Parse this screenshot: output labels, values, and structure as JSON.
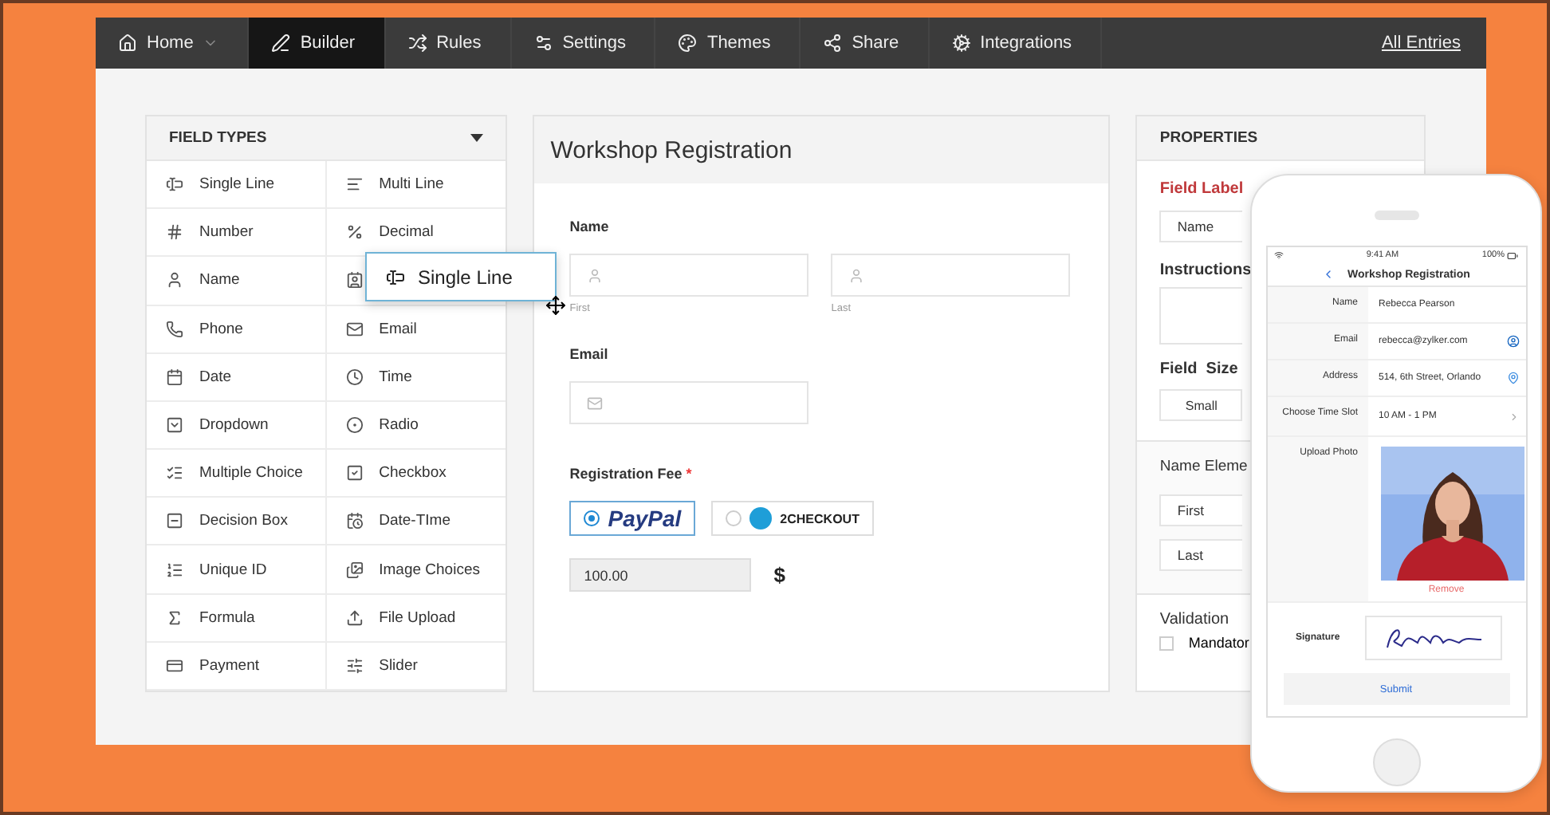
{
  "nav": {
    "items": [
      {
        "label": "Home",
        "dropdown": true,
        "selected": false
      },
      {
        "label": "Builder",
        "dropdown": false,
        "selected": true
      },
      {
        "label": "Rules",
        "dropdown": false,
        "selected": false
      },
      {
        "label": "Settings",
        "dropdown": false,
        "selected": false
      },
      {
        "label": "Themes",
        "dropdown": false,
        "selected": false
      },
      {
        "label": "Share",
        "dropdown": false,
        "selected": false
      },
      {
        "label": "Integrations",
        "dropdown": false,
        "selected": false
      }
    ],
    "link": "All Entries"
  },
  "field_types": {
    "title": "FIELD TYPES",
    "items": [
      {
        "kind": "field",
        "label": "Single Line"
      },
      {
        "kind": "field",
        "label": "Multi Line"
      },
      {
        "kind": "field",
        "label": "Number"
      },
      {
        "kind": "field",
        "label": "Decimal"
      },
      {
        "kind": "field",
        "label": "Name"
      },
      {
        "kind": "covered"
      },
      {
        "kind": "field",
        "label": "Phone"
      },
      {
        "kind": "field",
        "label": "Email"
      },
      {
        "kind": "field",
        "label": "Date"
      },
      {
        "kind": "field",
        "label": "Time"
      },
      {
        "kind": "field",
        "label": "Dropdown"
      },
      {
        "kind": "field",
        "label": "Radio"
      },
      {
        "kind": "field",
        "label": "Multiple Choice"
      },
      {
        "kind": "field",
        "label": "Checkbox"
      },
      {
        "kind": "field",
        "label": "Decision Box"
      },
      {
        "kind": "field",
        "label": "Date-TIme"
      },
      {
        "kind": "field",
        "label": "Unique ID"
      },
      {
        "kind": "field",
        "label": "Image Choices"
      },
      {
        "kind": "field",
        "label": "Formula"
      },
      {
        "kind": "field",
        "label": "File Upload"
      },
      {
        "kind": "field",
        "label": "Payment"
      },
      {
        "kind": "field",
        "label": "Slider"
      }
    ],
    "dragging": {
      "label": "Single Line"
    }
  },
  "form": {
    "title": "Workshop Registration",
    "name": {
      "label": "Name",
      "parts": [
        "First",
        "Last"
      ]
    },
    "email": {
      "label": "Email"
    },
    "fee": {
      "label": "Registration Fee",
      "required_mark": "*",
      "options": [
        {
          "kind": "paypal",
          "label": "PayPal",
          "selected": true
        },
        {
          "kind": "twocheckout",
          "label": "2CHECKOUT",
          "selected": false
        }
      ],
      "amount": "100.00",
      "currency": "$"
    }
  },
  "properties": {
    "title": "PROPERTIES",
    "field_label": "Field Label",
    "field_value": "Name",
    "instructions": "Instructions",
    "field_size": "Field  Size",
    "size_option": "Small",
    "name_elements": "Name Eleme",
    "elements": [
      "First",
      "Last"
    ],
    "validation": "Validation",
    "mandatory": {
      "label": "Mandator",
      "checked": false
    }
  },
  "phone": {
    "time": "9:41 AM",
    "battery": "100%",
    "title": "Workshop Registration",
    "rows": [
      {
        "kind": "text",
        "label": "Name",
        "value": "Rebecca Pearson"
      },
      {
        "kind": "email",
        "label": "Email",
        "value": "rebecca@zylker.com"
      },
      {
        "kind": "address",
        "label": "Address",
        "value": "514, 6th Street, Orlando"
      },
      {
        "kind": "choice",
        "label": "Choose Time Slot",
        "value": "10 AM - 1 PM"
      },
      {
        "label": "Upload Photo",
        "action": "Remove"
      }
    ],
    "signature": "Signature",
    "submit": "Submit"
  }
}
